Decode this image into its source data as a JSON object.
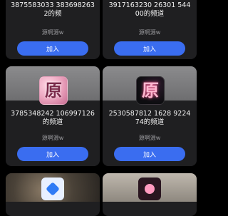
{
  "cards": [
    {
      "title": "3875583033 3836982632的频",
      "owner": "源啊源w",
      "join": "加入"
    },
    {
      "title": "3917163230 26301 54400的频道",
      "owner": "源啊源w",
      "join": "加入"
    },
    {
      "title": "3785348242 106997126的频道",
      "owner": "源啊源w",
      "join": "加入",
      "avatar_glyph": "原"
    },
    {
      "title": "2530587812 1628 922474的频道",
      "owner": "源啊源w",
      "join": "加入",
      "avatar_glyph": "原"
    }
  ],
  "colors": {
    "join_button": "#3a6df0",
    "card_bg": "#1f1f21",
    "page_bg": "#000000"
  },
  "icons": [
    "avatar-yuan-pink",
    "avatar-yuan-dark",
    "blue-shield-icon",
    "pink-app-icon"
  ]
}
